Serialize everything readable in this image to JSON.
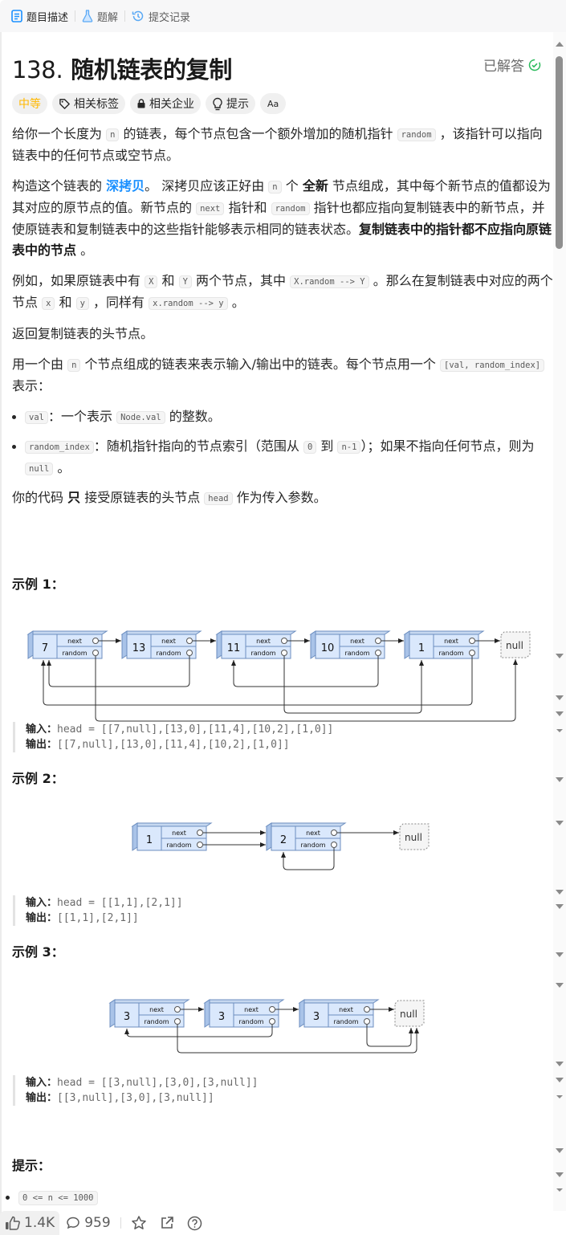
{
  "tabs": [
    {
      "label": "题目描述",
      "icon": "description-icon",
      "active": true
    },
    {
      "label": "题解",
      "icon": "flask-icon",
      "active": false
    },
    {
      "label": "提交记录",
      "icon": "history-icon",
      "active": false
    }
  ],
  "problem": {
    "number": "138.",
    "title": "随机链表的复制",
    "status": "已解答",
    "status_color": "#2cbb5d"
  },
  "tags": {
    "difficulty": "中等",
    "difficulty_color": "#ffb800",
    "related_tags": "相关标签",
    "related_companies": "相关企业",
    "hint": "提示",
    "font_toggle": "Aa"
  },
  "description": {
    "p1": {
      "t1": "给你一个长度为 ",
      "c1": "n",
      "t2": " 的链表，每个节点包含一个额外增加的随机指针 ",
      "c2": "random",
      "t3": " ，该指针可以指向链表中的任何节点或空节点。"
    },
    "p2": {
      "t1": "构造这个链表的 ",
      "link": "深拷贝",
      "t2": "。 深拷贝应该正好由 ",
      "c1": "n",
      "t3": " 个 ",
      "b1": "全新",
      "t4": " 节点组成，其中每个新节点的值都设为其对应的原节点的值。新节点的 ",
      "c2": "next",
      "t5": " 指针和 ",
      "c3": "random",
      "t6": " 指针也都应指向复制链表中的新节点，并使原链表和复制链表中的这些指针能够表示相同的链表状态。",
      "b2": "复制链表中的指针都不应指向原链表中的节点",
      "t7": " 。"
    },
    "p3": {
      "t1": "例如，如果原链表中有 ",
      "c1": "X",
      "t2": " 和 ",
      "c2": "Y",
      "t3": " 两个节点，其中 ",
      "c3": "X.random --> Y",
      "t4": " 。那么在复制链表中对应的两个节点 ",
      "c4": "x",
      "t5": " 和 ",
      "c5": "y",
      "t6": " ，同样有 ",
      "c6": "x.random --> y",
      "t7": " 。"
    },
    "p4": "返回复制链表的头节点。",
    "p5": {
      "t1": "用一个由 ",
      "c1": "n",
      "t2": " 个节点组成的链表来表示输入/输出中的链表。每个节点用一个 ",
      "c2": "[val, random_index]",
      "t3": " 表示："
    },
    "bullets": [
      {
        "c1": "val",
        "t1": "：一个表示 ",
        "c2": "Node.val",
        "t2": " 的整数。"
      },
      {
        "c1": "random_index",
        "t1": "：随机指针指向的节点索引（范围从 ",
        "c2": "0",
        "t2": " 到 ",
        "c3": "n-1",
        "t3": "）；如果不指向任何节点，则为 ",
        "c4": "null",
        "t4": " 。"
      }
    ],
    "p6": {
      "t1": "你的代码 ",
      "b1": "只",
      "t2": " 接受原链表的头节点 ",
      "c1": "head",
      "t3": " 作为传入参数。"
    }
  },
  "examples": [
    {
      "heading": "示例 1：",
      "nodes": [
        "7",
        "13",
        "11",
        "10",
        "1"
      ],
      "input_label": "输入：",
      "input": "head = [[7,null],[13,0],[11,4],[10,2],[1,0]]",
      "output_label": "输出：",
      "output": "[[7,null],[13,0],[11,4],[10,2],[1,0]]"
    },
    {
      "heading": "示例 2：",
      "nodes": [
        "1",
        "2"
      ],
      "input_label": "输入：",
      "input": "head = [[1,1],[2,1]]",
      "output_label": "输出：",
      "output": "[[1,1],[2,1]]"
    },
    {
      "heading": "示例 3：",
      "nodes": [
        "3",
        "3",
        "3"
      ],
      "input_label": "输入：",
      "input": "head = [[3,null],[3,0],[3,null]]",
      "output_label": "输出：",
      "output": "[[3,null],[3,0],[3,null]]"
    }
  ],
  "diagram_labels": {
    "next": "next",
    "random": "random",
    "null": "null"
  },
  "constraints": {
    "heading": "提示：",
    "items": [
      "0 <= n <= 1000"
    ]
  },
  "footer": {
    "likes": "1.4K",
    "comments": "959"
  }
}
